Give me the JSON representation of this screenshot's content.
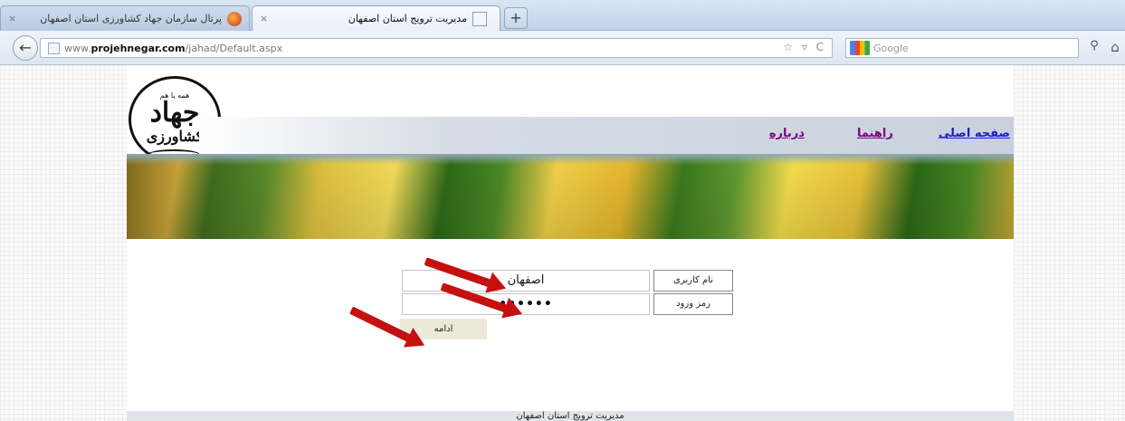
{
  "browser": {
    "tabs": [
      {
        "title": "پرتال سازمان جهاد کشاورزی استان اصفهان",
        "active": false
      },
      {
        "title": "مدیریت ترویج استان اصفهان",
        "active": true
      }
    ],
    "new_tab_symbol": "+",
    "close_symbol": "×",
    "back_symbol": "←",
    "url_prefix": "www.",
    "url_domain": "projehnegar.com",
    "url_path": "/jahad/Default.aspx",
    "url_actions": "☆ ▿ C",
    "search_placeholder": "Google",
    "search_symbol": "⚲",
    "home_symbol": "⌂"
  },
  "page": {
    "logo": {
      "slogan": "همه با هم",
      "main": "جهاد",
      "sub": "کشاورزی"
    },
    "nav": {
      "home": "صفحه اصلی",
      "guide": "راهنما",
      "about": "درباره"
    },
    "form": {
      "username_label": "نام کاربری",
      "username_value": "اصفهان",
      "password_label": "رمز ورود",
      "password_value": "••••••",
      "submit_label": "ادامه"
    },
    "footer": "مدیریت ترویج استان اصفهان"
  },
  "colors": {
    "arrow": "#c51010",
    "link": "#1b1bcc",
    "link_visited": "#800080"
  }
}
